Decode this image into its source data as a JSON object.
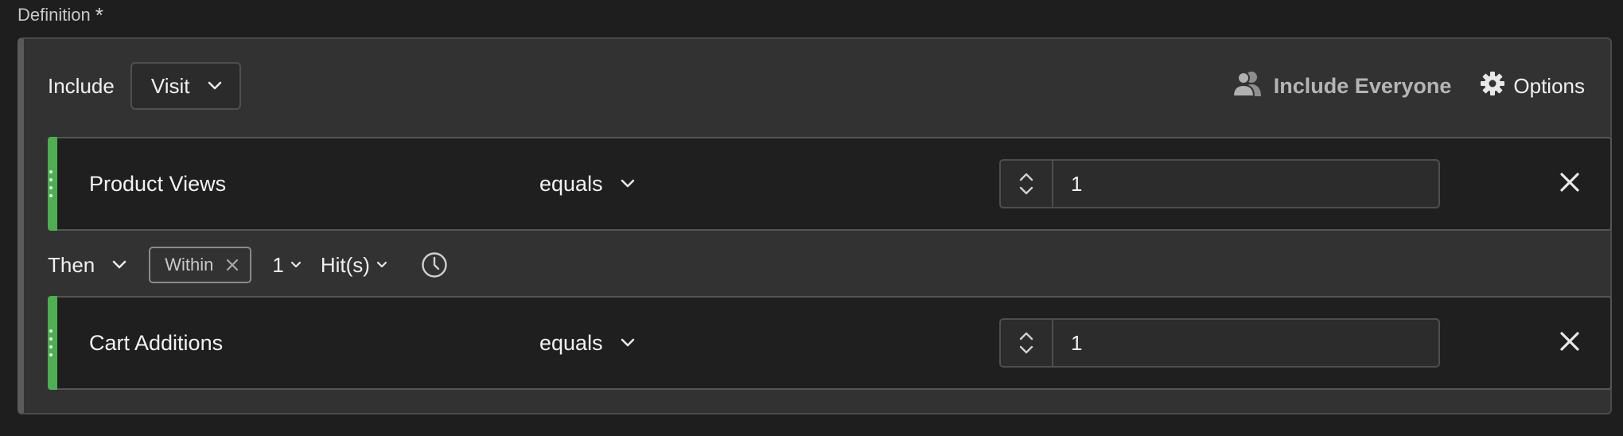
{
  "section": {
    "label": "Definition",
    "required_marker": "*"
  },
  "header": {
    "include_label": "Include",
    "container_value": "Visit",
    "include_everyone_label": "Include Everyone",
    "options_label": "Options"
  },
  "rules": [
    {
      "metric": "Product Views",
      "operator": "equals",
      "value": "1"
    },
    {
      "metric": "Cart Additions",
      "operator": "equals",
      "value": "1"
    }
  ],
  "sequence": {
    "then_label": "Then",
    "within_tag": "Within",
    "count": "1",
    "unit": "Hit(s)"
  },
  "icons": {
    "chevron": "chevron-down-icon",
    "people": "people-icon",
    "gear": "gear-icon",
    "close": "close-icon",
    "clock": "clock-icon"
  },
  "colors": {
    "rule_accent": "#4caf50",
    "background": "#1e1e1e",
    "panel": "#323232"
  }
}
